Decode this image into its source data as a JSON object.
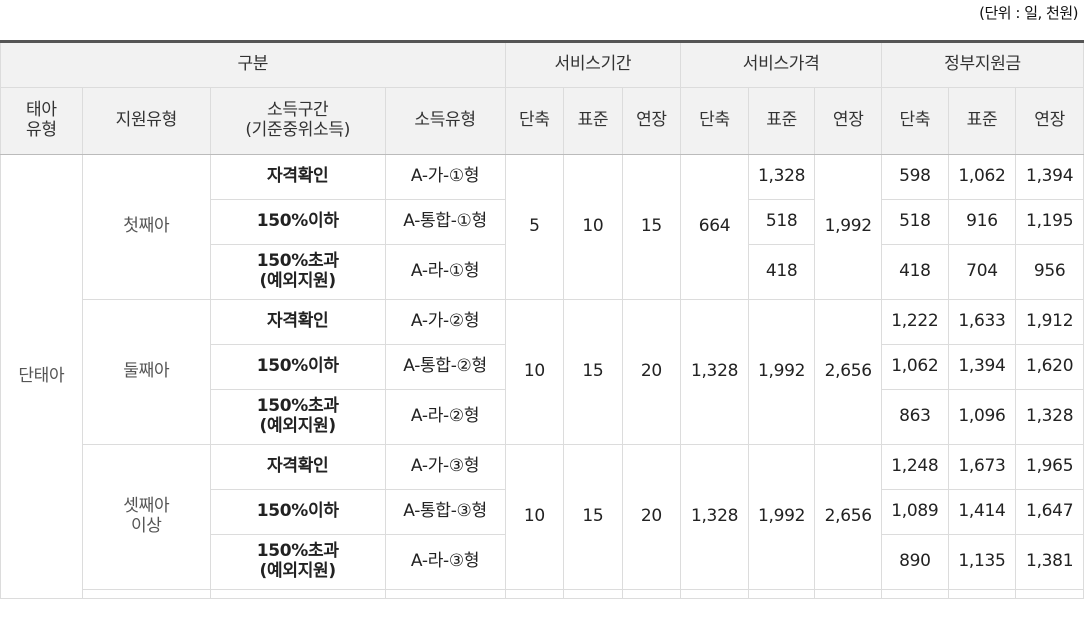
{
  "unit_note": "(단위 : 일, 천원)",
  "header": {
    "group_gubun": "구분",
    "group_service_period": "서비스기간",
    "group_service_price": "서비스가격",
    "group_gov_support": "정부지원금",
    "col_fetus_type": "태아\n유형",
    "col_support_type": "지원유형",
    "col_income_range": "소득구간\n(기준중위소득)",
    "col_income_type": "소득유형",
    "sub_short": "단축",
    "sub_standard": "표준",
    "sub_extended": "연장"
  },
  "fetus_type": "단태아",
  "groups": [
    {
      "support_type": "첫째아",
      "period": {
        "short": "5",
        "standard": "10",
        "extended": "15"
      },
      "price_short": "664",
      "price_standard": [
        "1,328",
        "518",
        "418"
      ],
      "price_extended": "1,992",
      "rows": [
        {
          "income_range": "자격확인",
          "income_type": "A-가-①형",
          "gov": [
            "598",
            "1,062",
            "1,394"
          ]
        },
        {
          "income_range": "150%이하",
          "income_type": "A-통합-①형",
          "gov": [
            "518",
            "916",
            "1,195"
          ]
        },
        {
          "income_range": "150%초과\n(예외지원)",
          "income_type": "A-라-①형",
          "gov": [
            "418",
            "704",
            "956"
          ]
        }
      ]
    },
    {
      "support_type": "둘째아",
      "period": {
        "short": "10",
        "standard": "15",
        "extended": "20"
      },
      "price": {
        "short": "1,328",
        "standard": "1,992",
        "extended": "2,656"
      },
      "rows": [
        {
          "income_range": "자격확인",
          "income_type": "A-가-②형",
          "gov": [
            "1,222",
            "1,633",
            "1,912"
          ]
        },
        {
          "income_range": "150%이하",
          "income_type": "A-통합-②형",
          "gov": [
            "1,062",
            "1,394",
            "1,620"
          ]
        },
        {
          "income_range": "150%초과\n(예외지원)",
          "income_type": "A-라-②형",
          "gov": [
            "863",
            "1,096",
            "1,328"
          ]
        }
      ]
    },
    {
      "support_type": "셋째아\n이상",
      "period": {
        "short": "10",
        "standard": "15",
        "extended": "20"
      },
      "price": {
        "short": "1,328",
        "standard": "1,992",
        "extended": "2,656"
      },
      "rows": [
        {
          "income_range": "자격확인",
          "income_type": "A-가-③형",
          "gov": [
            "1,248",
            "1,673",
            "1,965"
          ]
        },
        {
          "income_range": "150%이하",
          "income_type": "A-통합-③형",
          "gov": [
            "1,089",
            "1,414",
            "1,647"
          ]
        },
        {
          "income_range": "150%초과\n(예외지원)",
          "income_type": "A-라-③형",
          "gov": [
            "890",
            "1,135",
            "1,381"
          ]
        }
      ]
    }
  ]
}
